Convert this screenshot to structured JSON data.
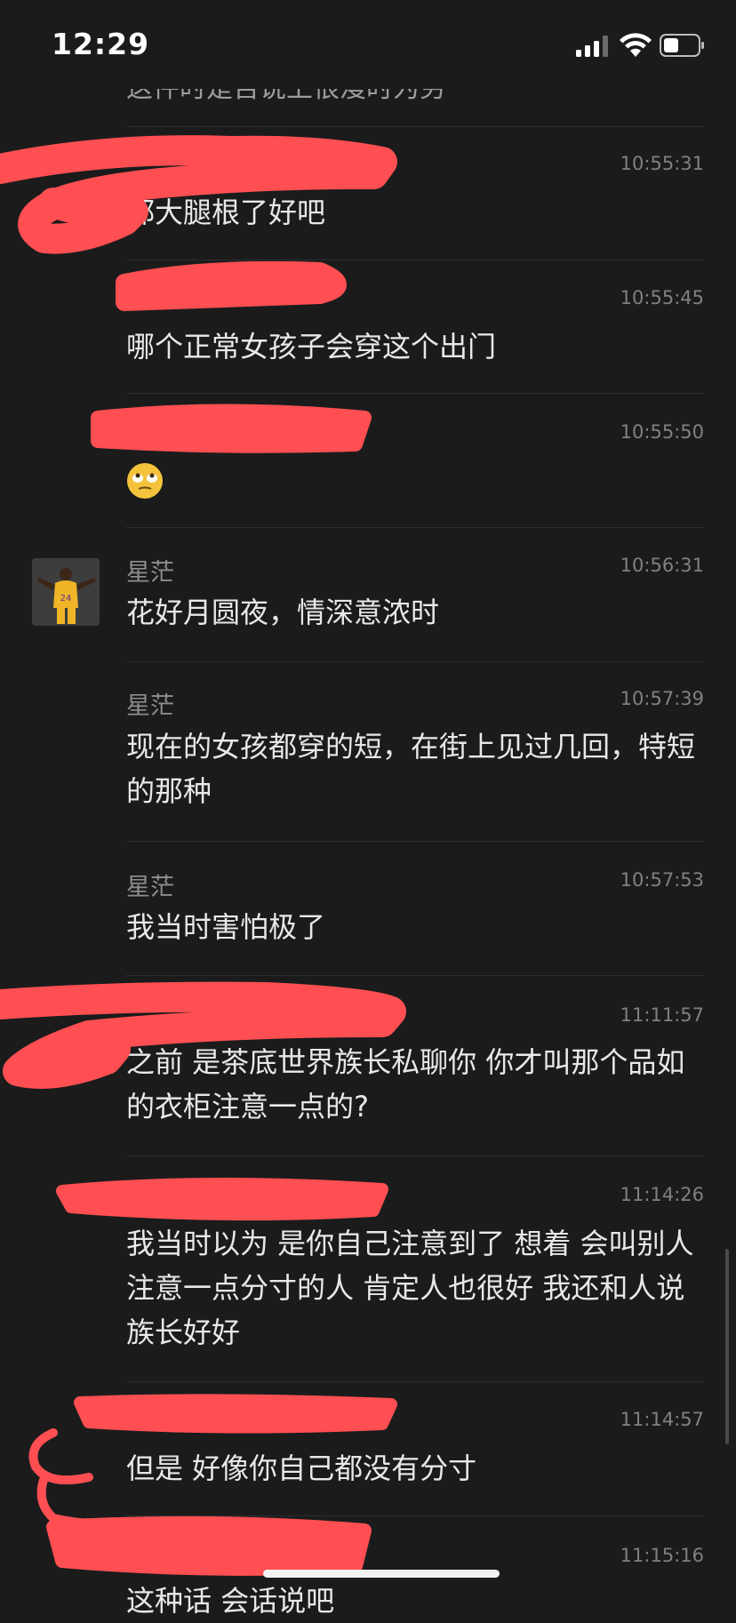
{
  "status_bar": {
    "time": "12:29"
  },
  "colors": {
    "background": "#1b1b1c",
    "redaction": "#ff4f52",
    "timestamp": "#808080",
    "sender": "#8e8e8e",
    "text": "#e8e8e8"
  },
  "cut_off_top_text": "这件时是否说上很漫时为劳",
  "messages": [
    {
      "time": "10:55:31",
      "text": "都大腿根了好吧"
    },
    {
      "time": "10:55:45",
      "text": "哪个正常女孩子会穿这个出门"
    },
    {
      "time": "10:55:50",
      "emoji": "rolling-eyes-emoji"
    },
    {
      "sender": "星茫",
      "time": "10:56:31",
      "text": "花好月圆夜，情深意浓时",
      "avatar": "basketball-player-avatar"
    },
    {
      "sender": "星茫",
      "time": "10:57:39",
      "text": "现在的女孩都穿的短，在街上见过几回，特短的那种"
    },
    {
      "sender": "星茫",
      "time": "10:57:53",
      "text": "我当时害怕极了"
    },
    {
      "time": "11:11:57",
      "text": "之前 是茶底世界族长私聊你 你才叫那个品如的衣柜注意一点的?"
    },
    {
      "time": "11:14:26",
      "text": "我当时以为 是你自己注意到了 想着 会叫别人注意一点分寸的人 肯定人也很好 我还和人说 族长好好"
    },
    {
      "time": "11:14:57",
      "text": "但是 好像你自己都没有分寸"
    },
    {
      "time": "11:15:16",
      "text": "这种话 会话说吧"
    }
  ]
}
